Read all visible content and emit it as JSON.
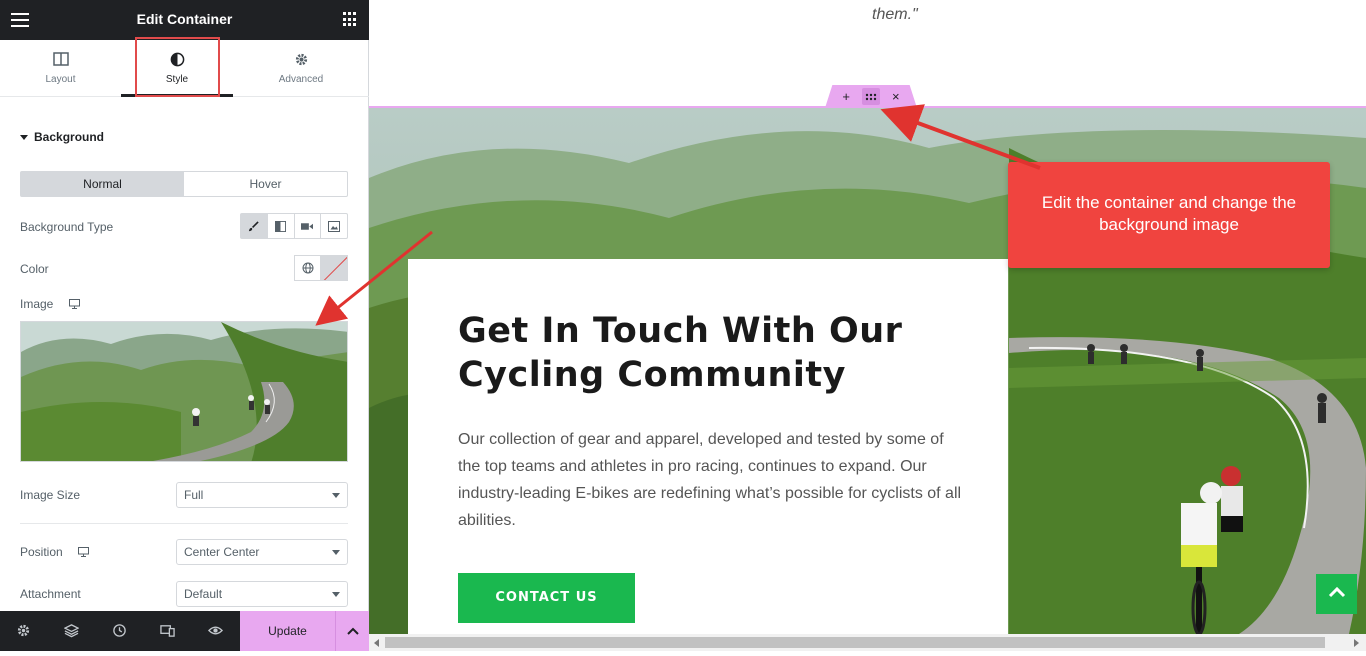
{
  "panel": {
    "title": "Edit Container",
    "tabs": [
      {
        "label": "Layout",
        "icon": "layout-columns-icon"
      },
      {
        "label": "Style",
        "icon": "half-circle-style-icon"
      },
      {
        "label": "Advanced",
        "icon": "gear-icon"
      }
    ],
    "active_tab": "Style",
    "section_title": "Background",
    "states": [
      "Normal",
      "Hover"
    ],
    "active_state": "Normal",
    "background_type_label": "Background Type",
    "background_types": [
      "brush-icon",
      "gradient-icon",
      "video-icon",
      "slideshow-icon"
    ],
    "color_label": "Color",
    "image_label": "Image",
    "image_size_label": "Image Size",
    "image_size_value": "Full",
    "position_label": "Position",
    "position_value": "Center Center",
    "attachment_label": "Attachment",
    "attachment_value": "Default",
    "footer": {
      "icons": [
        "settings-icon",
        "layers-icon",
        "history-icon",
        "responsive-icon",
        "preview-eye-icon"
      ],
      "update_label": "Update"
    }
  },
  "preview": {
    "quote_tail": "them.\"",
    "card": {
      "title": "Get In Touch With Our Cycling Community",
      "text": "Our collection of gear and apparel, developed and tested by some of the top teams and athletes in pro racing, continues to expand. Our industry-leading E-bikes are redefining what’s possible for cyclists of all abilities.",
      "button_label": "CONTACT US"
    },
    "callout_text": "Edit the container and change the background image"
  },
  "colors": {
    "accent_pink": "#e8a8f0",
    "brand_green": "#1ab84f",
    "callout_red": "#f0443f",
    "dark": "#1f2124"
  }
}
